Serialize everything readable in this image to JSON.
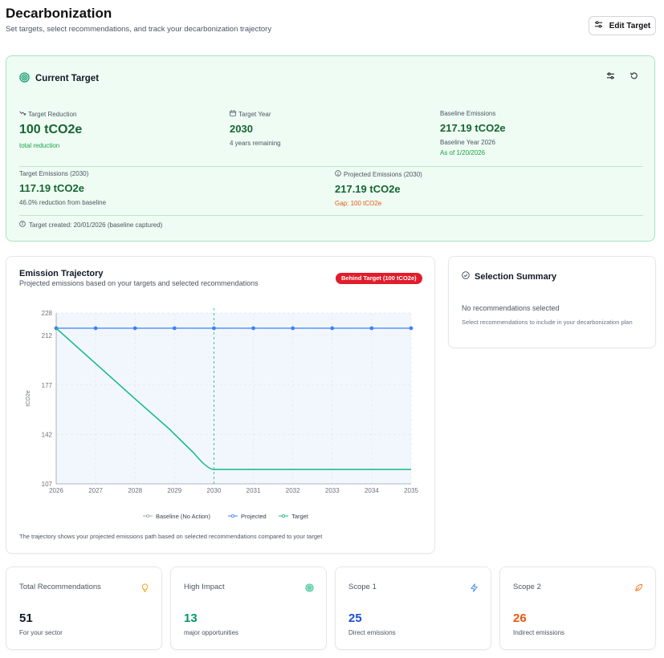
{
  "header": {
    "title": "Decarbonization",
    "subtitle": "Set targets, select recommendations, and track your decarbonization trajectory",
    "edit_button": "Edit Target"
  },
  "current_target": {
    "title": "Current Target",
    "target_reduction": {
      "label": "Target Reduction",
      "value": "100 tCO2e",
      "sub": "total reduction"
    },
    "target_year": {
      "label": "Target Year",
      "value": "2030",
      "sub": "4 years remaining"
    },
    "baseline": {
      "label": "Baseline Emissions",
      "value": "217.19 tCO2e",
      "sub": "Baseline Year 2026",
      "sub2": "As of 1/20/2026"
    },
    "target_emissions": {
      "label": "Target Emissions (2030)",
      "value": "117.19 tCO2e",
      "sub": "46.0% reduction from baseline"
    },
    "projected": {
      "label": "Projected Emissions (2030)",
      "value": "217.19 tCO2e",
      "sub": "Gap: 100 tCO2e"
    },
    "created": "Target created: 20/01/2026 (baseline captured)"
  },
  "trajectory": {
    "title": "Emission Trajectory",
    "subtitle": "Projected emissions based on your targets and selected recommendations",
    "badge": "Behind Target (100 tCO2e)",
    "footnote": "The trajectory shows your projected emissions path based on selected recommendations compared to your target"
  },
  "selection": {
    "title": "Selection Summary",
    "empty": "No recommendations selected",
    "hint": "Select recommendations to include in your decarbonization plan"
  },
  "stats": [
    {
      "label": "Total Recommendations",
      "value": "51",
      "sub": "For your sector",
      "color": "#111827",
      "icon": "lightbulb-icon",
      "icon_color": "#f59e0b"
    },
    {
      "label": "High Impact",
      "value": "13",
      "sub": "major opportunities",
      "color": "#059669",
      "icon": "target-icon",
      "icon_color": "#10b981"
    },
    {
      "label": "Scope 1",
      "value": "25",
      "sub": "Direct emissions",
      "color": "#1d4ed8",
      "icon": "lightning-icon",
      "icon_color": "#3b82f6"
    },
    {
      "label": "Scope 2",
      "value": "26",
      "sub": "Indirect emissions",
      "color": "#ea580c",
      "icon": "leaf-icon",
      "icon_color": "#f97316"
    }
  ],
  "chart_data": {
    "type": "line",
    "x": [
      2026,
      2027,
      2028,
      2029,
      2030,
      2031,
      2032,
      2033,
      2034,
      2035
    ],
    "series": [
      {
        "name": "Baseline (No Action)",
        "values": [
          217.19,
          217.19,
          217.19,
          217.19,
          217.19,
          217.19,
          217.19,
          217.19,
          217.19,
          217.19
        ],
        "color": "#9ca3af"
      },
      {
        "name": "Projected",
        "values": [
          217.19,
          217.19,
          217.19,
          217.19,
          217.19,
          217.19,
          217.19,
          217.19,
          217.19,
          217.19
        ],
        "color": "#3b82f6"
      },
      {
        "name": "Target",
        "values": [
          217.19,
          192.19,
          167.19,
          142.19,
          117.19,
          117.19,
          117.19,
          117.19,
          117.19,
          117.19
        ],
        "color": "#10b981"
      }
    ],
    "ylabel": "tCO2e",
    "ylim": [
      107,
      228
    ],
    "yticks": [
      107,
      142,
      177,
      212,
      228
    ],
    "target_year_marker": 2030,
    "grid": true,
    "legend": "bottom"
  }
}
